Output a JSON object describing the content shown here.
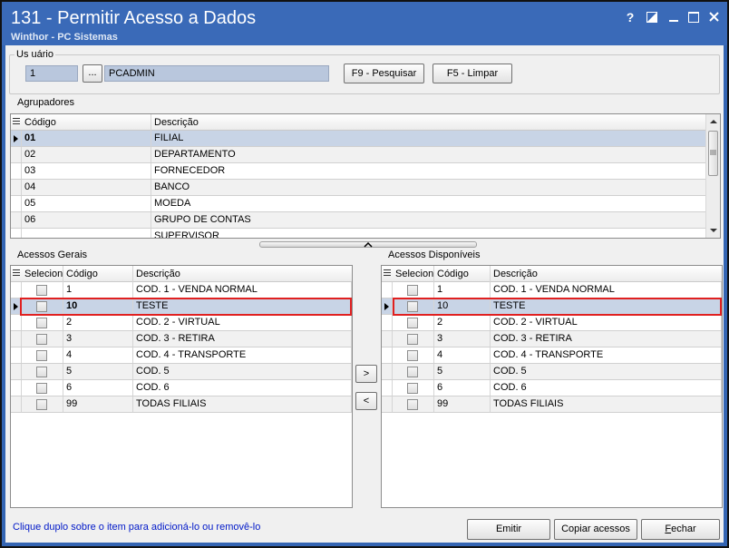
{
  "window": {
    "title": "131 - Permitir Acesso a Dados",
    "subtitle": "Winthor - PC Sistemas",
    "controls": [
      "help-icon",
      "restore-icon",
      "minimize-icon",
      "maximize-icon",
      "close-icon"
    ]
  },
  "usuario": {
    "group_label": "Us uário",
    "code_value": "1",
    "browse_label": "...",
    "name_value": "PCADMIN",
    "search_button": "F9 - Pesquisar",
    "clear_button": "F5 - Limpar"
  },
  "agrupadores": {
    "group_label": "Agrupadores",
    "columns": [
      "Código",
      "Descrição"
    ],
    "rows": [
      {
        "codigo": "01",
        "descricao": "FILIAL"
      },
      {
        "codigo": "02",
        "descricao": "DEPARTAMENTO"
      },
      {
        "codigo": "03",
        "descricao": "FORNECEDOR"
      },
      {
        "codigo": "04",
        "descricao": "BANCO"
      },
      {
        "codigo": "05",
        "descricao": "MOEDA"
      },
      {
        "codigo": "06",
        "descricao": "GRUPO DE CONTAS"
      },
      {
        "codigo": "",
        "descricao": "SUPERVISOR"
      }
    ],
    "selected_row": 0
  },
  "acessos_gerais": {
    "group_label": "Acessos Gerais",
    "columns": [
      "Selecionar",
      "Código",
      "Descrição"
    ],
    "rows": [
      {
        "codigo": "1",
        "descricao": "COD. 1 - VENDA NORMAL"
      },
      {
        "codigo": "10",
        "descricao": "TESTE"
      },
      {
        "codigo": "2",
        "descricao": "COD. 2 - VIRTUAL"
      },
      {
        "codigo": "3",
        "descricao": "COD. 3 - RETIRA"
      },
      {
        "codigo": "4",
        "descricao": "COD. 4 - TRANSPORTE"
      },
      {
        "codigo": "5",
        "descricao": "COD. 5"
      },
      {
        "codigo": "6",
        "descricao": "COD. 6"
      },
      {
        "codigo": "99",
        "descricao": "TODAS FILIAIS"
      }
    ],
    "selected_row": 1
  },
  "acessos_disponiveis": {
    "group_label": "Acessos Disponíveis",
    "columns": [
      "Selecionar",
      "Código",
      "Descrição"
    ],
    "rows": [
      {
        "codigo": "1",
        "descricao": "COD. 1 - VENDA NORMAL"
      },
      {
        "codigo": "10",
        "descricao": "TESTE"
      },
      {
        "codigo": "2",
        "descricao": "COD. 2 - VIRTUAL"
      },
      {
        "codigo": "3",
        "descricao": "COD. 3 - RETIRA"
      },
      {
        "codigo": "4",
        "descricao": "COD. 4 - TRANSPORTE"
      },
      {
        "codigo": "5",
        "descricao": "COD. 5"
      },
      {
        "codigo": "6",
        "descricao": "COD. 6"
      },
      {
        "codigo": "99",
        "descricao": "TODAS FILIAIS"
      }
    ],
    "selected_row": 1
  },
  "transfer": {
    "add_label": ">",
    "remove_label": "<"
  },
  "footer": {
    "hint": "Clique duplo sobre o item para adicioná-lo ou removê-lo",
    "emitir_button": "Emitir",
    "copiar_button": "Copiar acessos",
    "fechar_button": "Fechar"
  },
  "colors": {
    "titlebar": "#3a6ab8",
    "selection": "#c8d4e6",
    "highlight": "#e02020",
    "hint_text": "#0018c8"
  }
}
